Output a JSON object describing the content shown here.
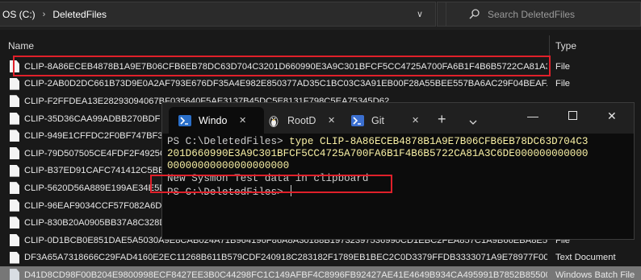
{
  "explorer": {
    "breadcrumb": [
      "OS (C:)",
      "DeletedFiles"
    ],
    "search_placeholder": "Search DeletedFiles",
    "columns": {
      "name": "Name",
      "type": "Type"
    },
    "rows": [
      {
        "name": "CLIP-8A86ECEB4878B1A9E7B06CFB6EB78DC63D704C3201D660990E3A9C301BFCF5CC4725A700FA6B1F4B6B5722CA81A3C...",
        "type": "File",
        "icon": "file-icon",
        "highlighted": true
      },
      {
        "name": "CLIP-2AB0D2DC661B73D9E0A2AF793E676DF35A4E982E850377AD35C1BC03C3A91EB00F28A55BEE557BA6AC29F04BEAF...",
        "type": "File",
        "icon": "file-icon"
      },
      {
        "name": "CLIP-F2FFDEA13E28293094067BF035640F5AE3137B45DC5E8131F798C5EA75345D62",
        "type": "",
        "icon": "file-icon"
      },
      {
        "name": "CLIP-35D36CAA99ADBB270BDF",
        "type": "",
        "icon": "file-icon"
      },
      {
        "name": "CLIP-949E1CFFDC2F0BF747BF31",
        "type": "",
        "icon": "file-icon"
      },
      {
        "name": "CLIP-79D507505CE4FDF2F4925C",
        "type": "",
        "icon": "file-icon"
      },
      {
        "name": "CLIP-B37ED91CAFC741412C5BE",
        "type": "",
        "icon": "file-icon"
      },
      {
        "name": "CLIP-5620D56A889E199AE34E5D",
        "type": "",
        "icon": "file-icon"
      },
      {
        "name": "CLIP-96EAF9034CCF57F082A6DD",
        "type": "",
        "icon": "file-icon"
      },
      {
        "name": "CLIP-830B20A0905BB37A8C328D",
        "type": "",
        "icon": "file-icon"
      },
      {
        "name": "CLIP-0D1BCB0E851DAE5A5030A9E8CAB024A71B964196F86A8A30188B19732397536990CD1EBC2FEA857C1A9B66EBA8E55...",
        "type": "File",
        "icon": "file-icon"
      },
      {
        "name": "DF3A65A7318666C29FAD4160E2EC11268B611B579CDF240918C283182F1789EB1BEC2C0D3379FFDB3333071A9E78977F0000...",
        "type": "Text Document",
        "icon": "file-icon"
      },
      {
        "name": "D41D8CD98F00B204E9800998ECF8427EE3B0C44298FC1C149AFBF4C8996FB92427AE41E4649B934CA495991B7852B8550000...",
        "type": "Windows Batch File",
        "icon": "batch-file-icon",
        "selected": true
      }
    ]
  },
  "terminal": {
    "tabs": [
      {
        "label": "Windo",
        "icon": "powershell-icon",
        "active": true
      },
      {
        "label": "RootD",
        "icon": "linux-penguin-icon"
      },
      {
        "label": "Git",
        "icon": "git-icon"
      }
    ],
    "new_tab": "+",
    "lines": {
      "prompt1": "PS C:\\DeletedFiles> ",
      "command": "type CLIP-8A86ECEB4878B1A9E7B06CFB6EB78DC63D704C3\n201D660990E3A9C301BFCF5CC4725A700FA6B1F4B6B5722CA81A3C6DE000000000000\n00000000000000000000",
      "output": "New Sysmon Test data in clipboard",
      "prompt2": "PS C:\\DeletedFiles> "
    }
  }
}
